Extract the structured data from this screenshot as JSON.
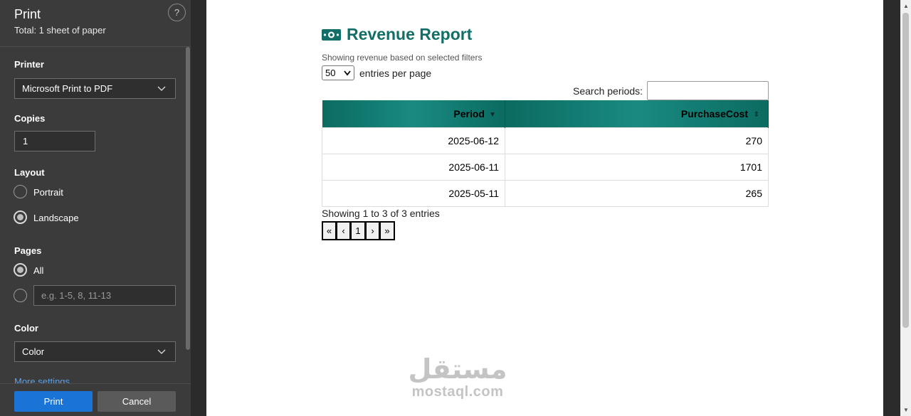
{
  "print_panel": {
    "title": "Print",
    "subtitle": "Total: 1 sheet of paper",
    "help": "?",
    "printer_label": "Printer",
    "printer_value": "Microsoft Print to PDF",
    "copies_label": "Copies",
    "copies_value": "1",
    "layout_label": "Layout",
    "layout_options": [
      "Portrait",
      "Landscape"
    ],
    "layout_selected": "Landscape",
    "pages_label": "Pages",
    "pages_all": "All",
    "pages_placeholder": "e.g. 1-5, 8, 11-13",
    "color_label": "Color",
    "color_value": "Color",
    "more_settings": "More settings",
    "print_button": "Print",
    "cancel_button": "Cancel"
  },
  "report": {
    "title": "Revenue Report",
    "subtitle": "Showing revenue based on selected filters",
    "entries_value": "50",
    "entries_suffix": "entries per page",
    "search_label": "Search periods:",
    "columns": [
      "Period",
      "PurchaseCost"
    ],
    "rows": [
      [
        "2025-06-12",
        "270"
      ],
      [
        "2025-06-11",
        "1701"
      ],
      [
        "2025-05-11",
        "265"
      ]
    ],
    "info": "Showing 1 to 3 of 3 entries",
    "pager": [
      "«",
      "‹",
      "1",
      "›",
      "»"
    ]
  },
  "watermark": {
    "arabic": "مستقل",
    "latin": "mostaql.com"
  },
  "colors": {
    "accent": "#126e66",
    "print_blue": "#1a73d6"
  }
}
